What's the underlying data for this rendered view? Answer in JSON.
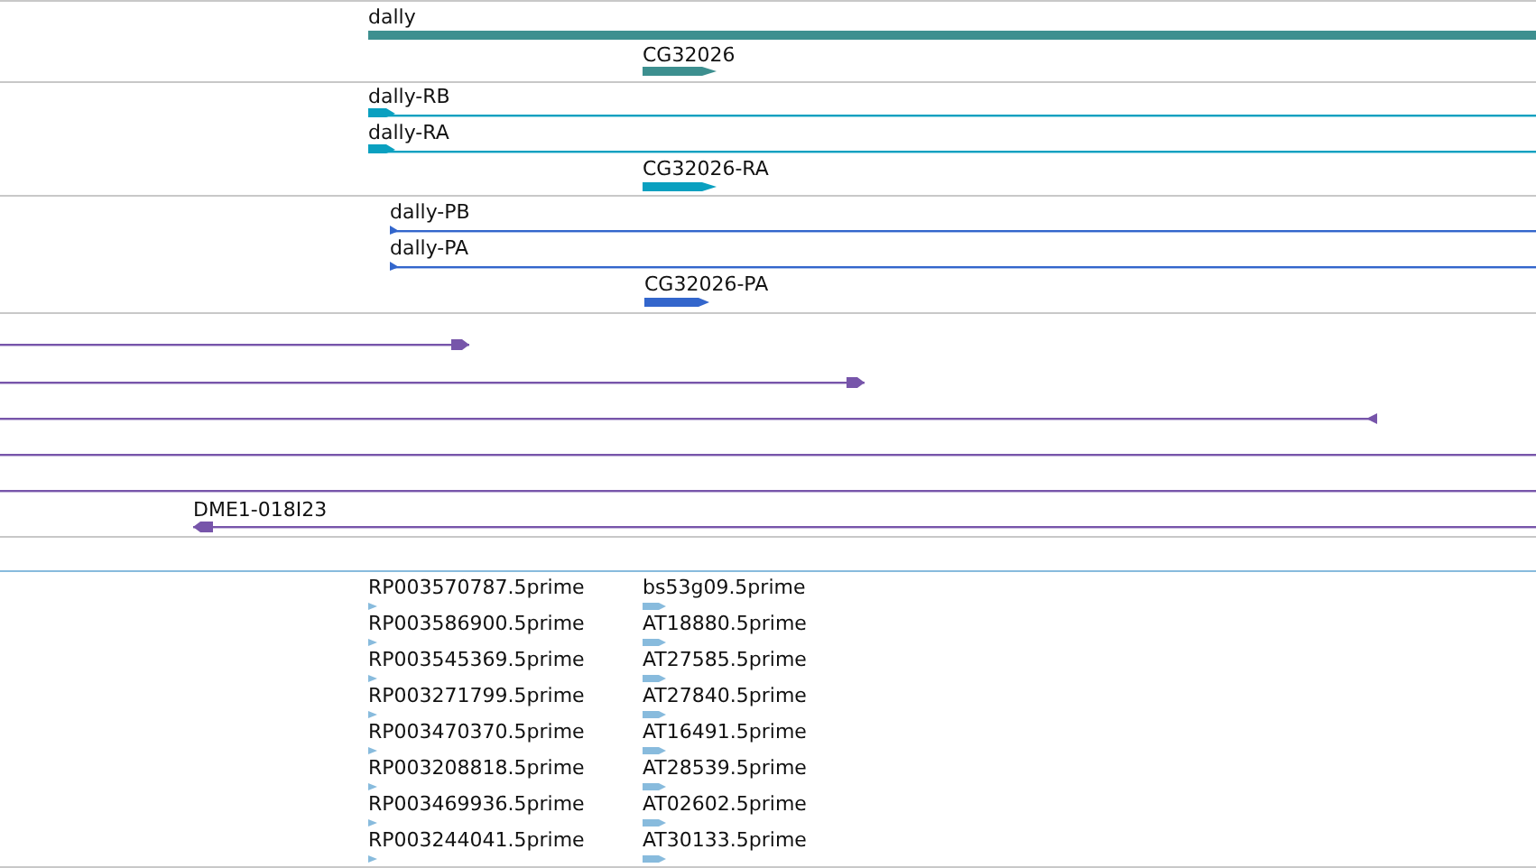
{
  "tracks": [
    {
      "kind": "genes",
      "features": [
        {
          "label": "dally"
        },
        {
          "label": "CG32026"
        }
      ]
    },
    {
      "kind": "transcripts",
      "features": [
        {
          "label": "dally-RB"
        },
        {
          "label": "dally-RA"
        },
        {
          "label": "CG32026-RA"
        }
      ]
    },
    {
      "kind": "proteins",
      "features": [
        {
          "label": "dally-PB"
        },
        {
          "label": "dally-PA"
        },
        {
          "label": "CG32026-PA"
        }
      ]
    },
    {
      "kind": "alignments",
      "features": [
        {
          "arrow_right": true,
          "arrow_left": false
        },
        {
          "arrow_right": true,
          "arrow_left": false
        },
        {
          "arrow_right": false,
          "arrow_left": true
        },
        {
          "arrow_right": false,
          "arrow_left": false
        },
        {
          "arrow_right": false,
          "arrow_left": false
        },
        {
          "label": "DME1-018I23",
          "arrow_right": false,
          "arrow_left": true
        }
      ]
    },
    {
      "kind": "ests",
      "features": [
        {
          "label": "RP003570787.5prime"
        },
        {
          "label": "bs53g09.5prime"
        },
        {
          "label": "RP003586900.5prime"
        },
        {
          "label": "AT18880.5prime"
        },
        {
          "label": "RP003545369.5prime"
        },
        {
          "label": "AT27585.5prime"
        },
        {
          "label": "RP003271799.5prime"
        },
        {
          "label": "AT27840.5prime"
        },
        {
          "label": "RP003470370.5prime"
        },
        {
          "label": "AT16491.5prime"
        },
        {
          "label": "RP003208818.5prime"
        },
        {
          "label": "AT28539.5prime"
        },
        {
          "label": "RP003469936.5prime"
        },
        {
          "label": "AT02602.5prime"
        },
        {
          "label": "RP003244041.5prime"
        },
        {
          "label": "AT30133.5prime"
        }
      ]
    }
  ]
}
